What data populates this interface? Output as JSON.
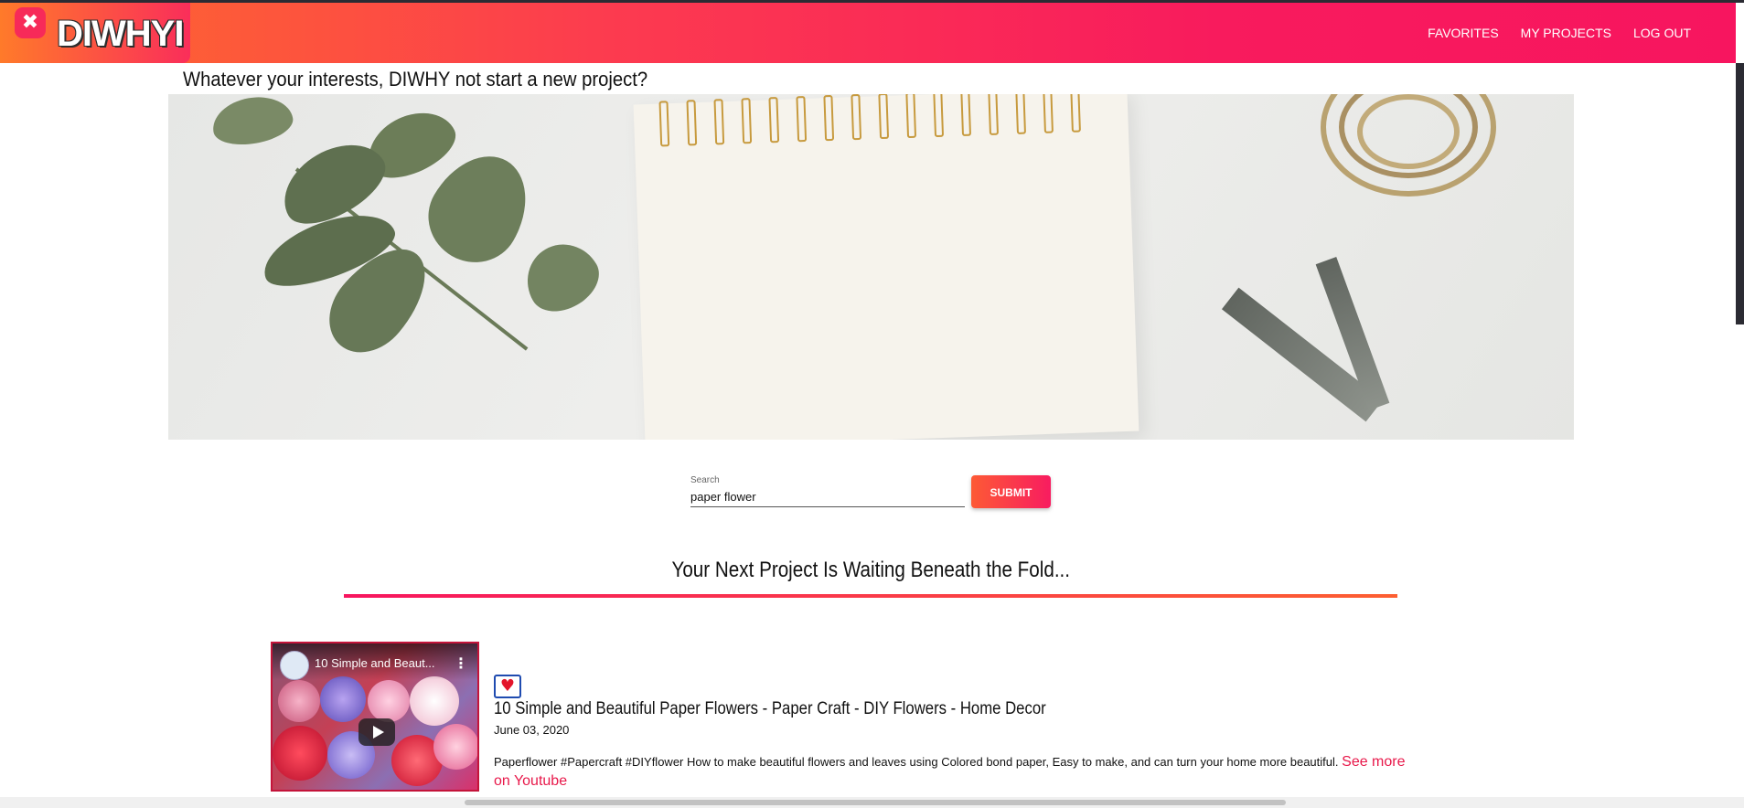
{
  "brand": {
    "logo_text": "DIWHYI",
    "logo_symbol": "✖"
  },
  "nav": {
    "links": [
      "FAVORITES",
      "MY PROJECTS",
      "LOG OUT"
    ]
  },
  "tagline": "Whatever your interests, DIWHY not start a new project?",
  "search": {
    "label": "Search",
    "value": "paper flower",
    "submit_label": "SUBMIT"
  },
  "section": {
    "heading": "Your Next Project Is Waiting Beneath the Fold..."
  },
  "results": [
    {
      "thumb_title": "10 Simple and Beaut...",
      "favorite_icon": "♥",
      "title": "10 Simple and Beautiful Paper Flowers - Paper Craft - DIY Flowers - Home Decor",
      "date": "June 03, 2020",
      "description": "Paperflower #Papercraft #DIYflower How to make beautiful flowers and leaves using Colored bond paper, Easy to make, and can turn your home more beautiful.",
      "see_more": "See more on Youtube"
    }
  ],
  "colors": {
    "accent_start": "#fe6c2c",
    "accent_end": "#f7155f",
    "see_more": "#e8184a",
    "fav_border": "#1f4bb0"
  }
}
